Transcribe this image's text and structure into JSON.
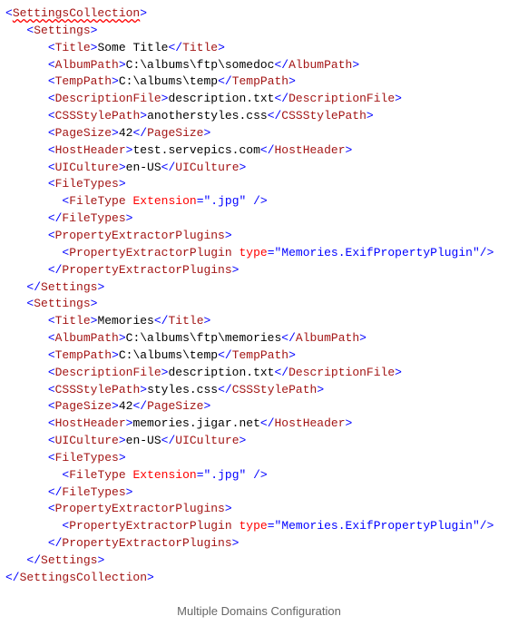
{
  "root": {
    "open": "SettingsCollection",
    "close": "SettingsCollection"
  },
  "settings": [
    {
      "tag": "Settings",
      "title_tag": "Title",
      "title": "Some Title",
      "albumpath_tag": "AlbumPath",
      "albumpath": "C:\\albums\\ftp\\somedoc",
      "temppath_tag": "TempPath",
      "temppath": "C:\\albums\\temp",
      "descfile_tag": "DescriptionFile",
      "descfile": "description.txt",
      "css_tag": "CSSStylePath",
      "css": "anotherstyles.css",
      "pagesize_tag": "PageSize",
      "pagesize": "42",
      "hostheader_tag": "HostHeader",
      "hostheader": "test.servepics.com",
      "uiculture_tag": "UICulture",
      "uiculture": "en-US",
      "filetypes_tag": "FileTypes",
      "filetype_tag": "FileType",
      "ext_attr": "Extension",
      "ext_val": "\".jpg\"",
      "plugins_tag": "PropertyExtractorPlugins",
      "plugin_tag": "PropertyExtractorPlugin",
      "type_attr": "type",
      "type_val": "\"Memories.ExifPropertyPlugin\""
    },
    {
      "tag": "Settings",
      "title_tag": "Title",
      "title": "Memories",
      "albumpath_tag": "AlbumPath",
      "albumpath": "C:\\albums\\ftp\\memories",
      "temppath_tag": "TempPath",
      "temppath": "C:\\albums\\temp",
      "descfile_tag": "DescriptionFile",
      "descfile": "description.txt",
      "css_tag": "CSSStylePath",
      "css": "styles.css",
      "pagesize_tag": "PageSize",
      "pagesize": "42",
      "hostheader_tag": "HostHeader",
      "hostheader": "memories.jigar.net",
      "uiculture_tag": "UICulture",
      "uiculture": "en-US",
      "filetypes_tag": "FileTypes",
      "filetype_tag": "FileType",
      "ext_attr": "Extension",
      "ext_val": "\".jpg\"",
      "plugins_tag": "PropertyExtractorPlugins",
      "plugin_tag": "PropertyExtractorPlugin",
      "type_attr": "type",
      "type_val": "\"Memories.ExifPropertyPlugin\""
    }
  ],
  "caption": "Multiple Domains Configuration"
}
